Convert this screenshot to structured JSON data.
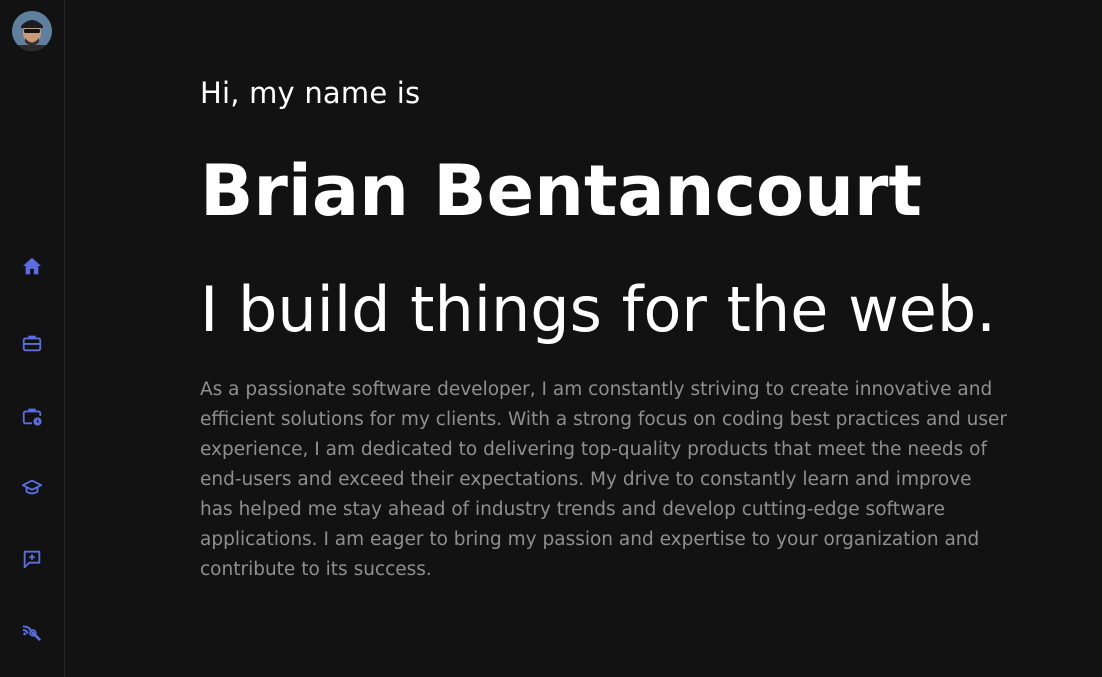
{
  "sidebar": {
    "avatar_icon": "avatar",
    "accent_color": "#5b6ee1",
    "items": [
      {
        "icon": "home-icon",
        "label": "Home"
      },
      {
        "icon": "briefcase-icon",
        "label": "Work"
      },
      {
        "icon": "briefcase-clock-icon",
        "label": "Experience"
      },
      {
        "icon": "graduation-cap-icon",
        "label": "Education"
      },
      {
        "icon": "message-plus-icon",
        "label": "Contact"
      },
      {
        "icon": "signal-wrench-icon",
        "label": "Skills"
      }
    ]
  },
  "hero": {
    "greeting": "Hi, my name is",
    "name": "Brian Bentancourt",
    "tagline": "I build things for the web.",
    "bio": "As a passionate software developer, I am constantly striving to create innovative and efficient solutions for my clients. With a strong focus on coding best practices and user experience, I am dedicated to delivering top-quality products that meet the needs of end-users and exceed their expectations. My drive to constantly learn and improve has helped me stay ahead of industry trends and develop cutting-edge software applications. I am eager to bring my passion and expertise to your organization and contribute to its success."
  },
  "colors": {
    "background": "#121212",
    "text_primary": "#ffffff",
    "text_secondary": "#8f8f8f"
  }
}
